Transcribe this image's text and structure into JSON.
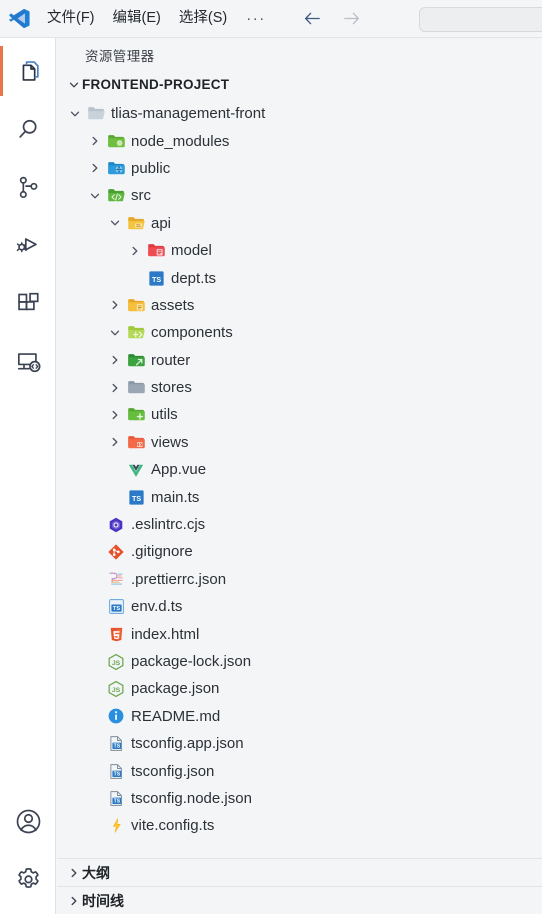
{
  "titlebar": {
    "logo": "vscode-logo",
    "menus": [
      {
        "label": "文件(F)",
        "name": "menu-file"
      },
      {
        "label": "编辑(E)",
        "name": "menu-edit"
      },
      {
        "label": "选择(S)",
        "name": "menu-selection"
      }
    ],
    "overflow": "···",
    "nav": {
      "back": "back-arrow-icon",
      "forward": "forward-arrow-icon"
    },
    "search_value": "",
    "search_placeholder": ""
  },
  "activitybar": {
    "items": [
      {
        "name": "explorer",
        "icon": "files-icon",
        "active": true
      },
      {
        "name": "search",
        "icon": "search-icon",
        "active": false
      },
      {
        "name": "source-control",
        "icon": "source-control-icon",
        "active": false
      },
      {
        "name": "run-debug",
        "icon": "run-and-debug-icon",
        "active": false
      },
      {
        "name": "extensions",
        "icon": "extensions-icon",
        "active": false
      },
      {
        "name": "remote-explorer",
        "icon": "remote-explorer-icon",
        "active": false
      }
    ],
    "bottom": [
      {
        "name": "accounts",
        "icon": "account-icon"
      },
      {
        "name": "manage",
        "icon": "gear-icon"
      }
    ]
  },
  "explorer": {
    "title": "资源管理器",
    "root_label": "FRONTEND-PROJECT",
    "tree": [
      {
        "label": "tlias-management-front",
        "depth": 1,
        "type": "folder",
        "icon": "folder-generic",
        "state": "expanded"
      },
      {
        "label": "node_modules",
        "depth": 2,
        "type": "folder",
        "icon": "folder-node",
        "state": "collapsed"
      },
      {
        "label": "public",
        "depth": 2,
        "type": "folder",
        "icon": "folder-public",
        "state": "collapsed"
      },
      {
        "label": "src",
        "depth": 2,
        "type": "folder",
        "icon": "folder-src",
        "state": "expanded"
      },
      {
        "label": "api",
        "depth": 3,
        "type": "folder",
        "icon": "folder-api",
        "state": "expanded"
      },
      {
        "label": "model",
        "depth": 4,
        "type": "folder",
        "icon": "folder-model",
        "state": "collapsed"
      },
      {
        "label": "dept.ts",
        "depth": 4,
        "type": "file",
        "icon": "typescript-icon",
        "state": "none"
      },
      {
        "label": "assets",
        "depth": 3,
        "type": "folder",
        "icon": "folder-assets",
        "state": "collapsed"
      },
      {
        "label": "components",
        "depth": 3,
        "type": "folder",
        "icon": "folder-components",
        "state": "expanded"
      },
      {
        "label": "router",
        "depth": 3,
        "type": "folder",
        "icon": "folder-router",
        "state": "collapsed"
      },
      {
        "label": "stores",
        "depth": 3,
        "type": "folder",
        "icon": "folder-stores",
        "state": "collapsed"
      },
      {
        "label": "utils",
        "depth": 3,
        "type": "folder",
        "icon": "folder-utils",
        "state": "collapsed"
      },
      {
        "label": "views",
        "depth": 3,
        "type": "folder",
        "icon": "folder-views",
        "state": "collapsed"
      },
      {
        "label": "App.vue",
        "depth": 3,
        "type": "file",
        "icon": "vue-icon",
        "state": "none"
      },
      {
        "label": "main.ts",
        "depth": 3,
        "type": "file",
        "icon": "typescript-icon",
        "state": "none"
      },
      {
        "label": ".eslintrc.cjs",
        "depth": 2,
        "type": "file",
        "icon": "eslint-icon",
        "state": "none"
      },
      {
        "label": ".gitignore",
        "depth": 2,
        "type": "file",
        "icon": "git-icon",
        "state": "none"
      },
      {
        "label": ".prettierrc.json",
        "depth": 2,
        "type": "file",
        "icon": "prettier-icon",
        "state": "none"
      },
      {
        "label": "env.d.ts",
        "depth": 2,
        "type": "file",
        "icon": "typescript-def-icon",
        "state": "none"
      },
      {
        "label": "index.html",
        "depth": 2,
        "type": "file",
        "icon": "html-icon",
        "state": "none"
      },
      {
        "label": "package-lock.json",
        "depth": 2,
        "type": "file",
        "icon": "npm-icon",
        "state": "none"
      },
      {
        "label": "package.json",
        "depth": 2,
        "type": "file",
        "icon": "npm-icon",
        "state": "none"
      },
      {
        "label": "README.md",
        "depth": 2,
        "type": "file",
        "icon": "readme-icon",
        "state": "none"
      },
      {
        "label": "tsconfig.app.json",
        "depth": 2,
        "type": "file",
        "icon": "tsconfig-icon",
        "state": "none"
      },
      {
        "label": "tsconfig.json",
        "depth": 2,
        "type": "file",
        "icon": "tsconfig-icon",
        "state": "none"
      },
      {
        "label": "tsconfig.node.json",
        "depth": 2,
        "type": "file",
        "icon": "tsconfig-icon",
        "state": "none"
      },
      {
        "label": "vite.config.ts",
        "depth": 2,
        "type": "file",
        "icon": "vite-icon",
        "state": "none"
      }
    ]
  },
  "panels": [
    {
      "label": "大纲",
      "name": "outline",
      "state": "collapsed"
    },
    {
      "label": "时间线",
      "name": "timeline",
      "state": "collapsed"
    }
  ],
  "colors": {
    "accent_active": "#e8764d",
    "titlebar_bg": "#f4f5f7",
    "sidebar_bg": "#f4f5f7",
    "activitybar_bg": "#ffffff",
    "text": "#2b3137",
    "icon_stroke": "#3b4252"
  }
}
